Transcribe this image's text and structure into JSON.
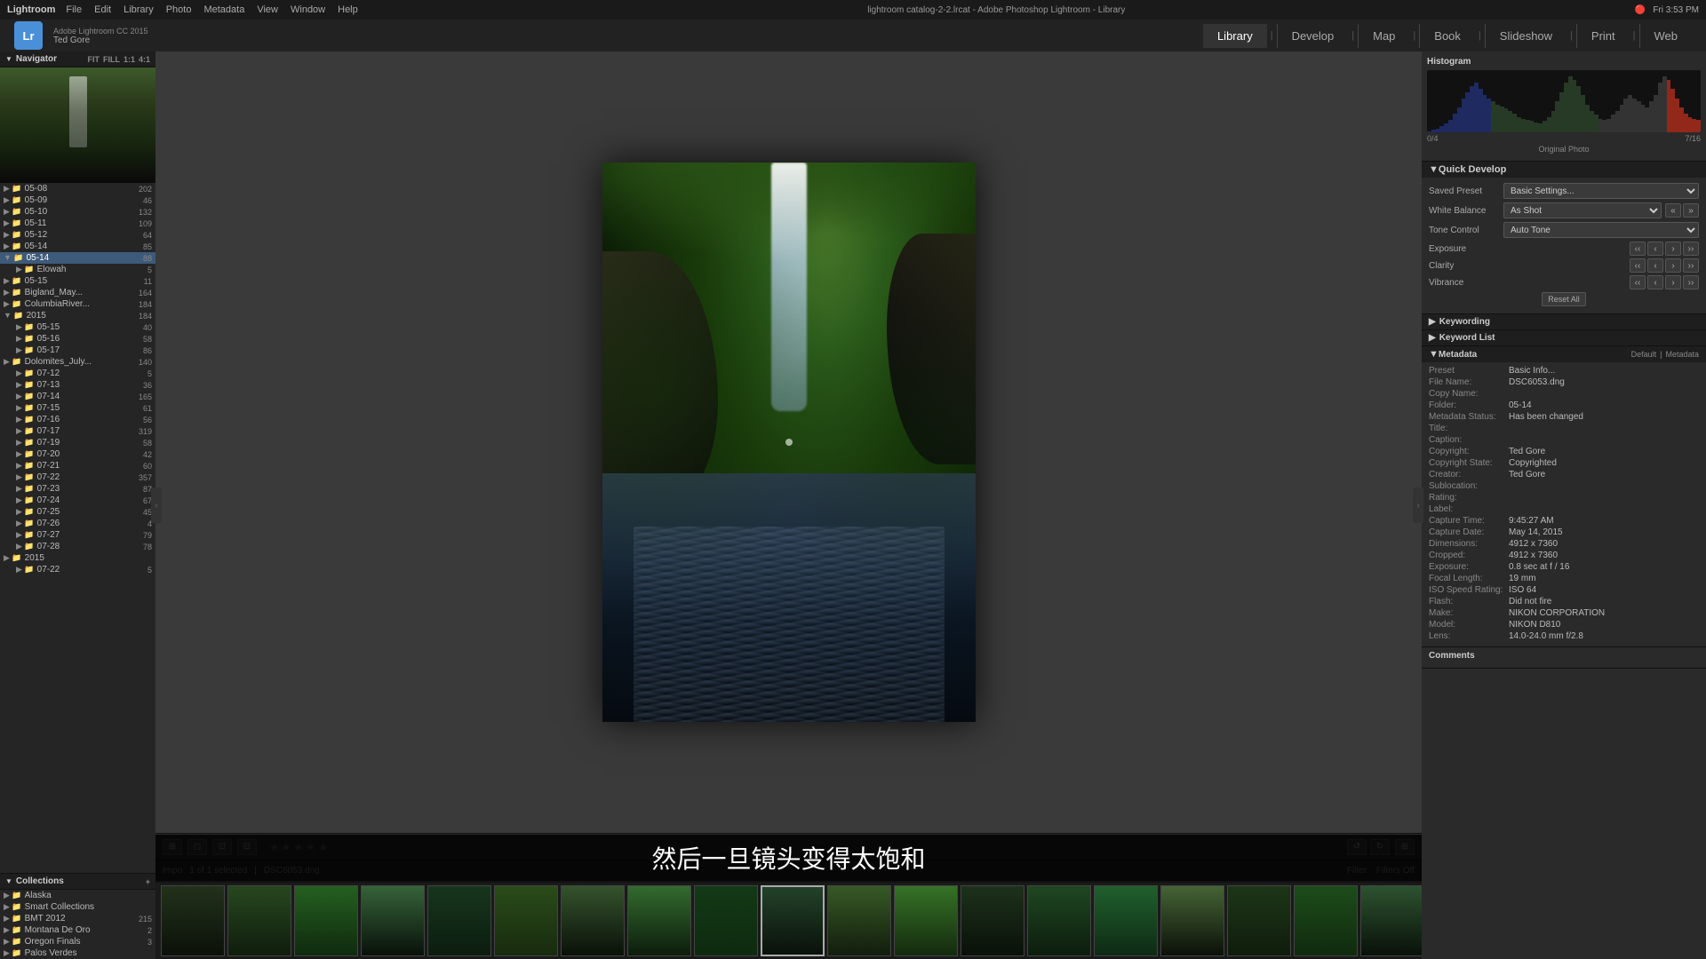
{
  "app": {
    "name": "Lightroom",
    "version": "Adobe Lightroom CC 2015",
    "user": "Ted Gore",
    "window_title": "lightroom catalog-2-2.lrcat - Adobe Photoshop Lightroom - Library"
  },
  "menu": {
    "items": [
      "File",
      "Edit",
      "Library",
      "Photo",
      "Metadata",
      "View",
      "Window",
      "Help"
    ]
  },
  "nav_tabs": [
    {
      "label": "Library",
      "active": true
    },
    {
      "label": "Develop"
    },
    {
      "label": "Map"
    },
    {
      "label": "Book"
    },
    {
      "label": "Slideshow"
    },
    {
      "label": "Print"
    },
    {
      "label": "Web"
    }
  ],
  "left_panel": {
    "navigator_label": "Navigator",
    "nav_controls": [
      "FIT",
      "FILL",
      "1:1",
      "4:1"
    ],
    "folders": [
      {
        "name": "05-08",
        "count": "202",
        "indent": 1
      },
      {
        "name": "05-09",
        "count": "46",
        "indent": 1
      },
      {
        "name": "05-10",
        "count": "132",
        "indent": 1
      },
      {
        "name": "05-11",
        "count": "109",
        "indent": 1
      },
      {
        "name": "05-12",
        "count": "64",
        "indent": 1
      },
      {
        "name": "05-14",
        "count": "85",
        "indent": 1
      },
      {
        "name": "05-14",
        "count": "88",
        "indent": 1,
        "selected": true,
        "expanded": true
      },
      {
        "name": "Elowah",
        "count": "5",
        "indent": 2
      },
      {
        "name": "05-15",
        "count": "11",
        "indent": 1
      },
      {
        "name": "Bigland_May...",
        "count": "164",
        "indent": 1
      },
      {
        "name": "ColumbiaRiver...",
        "count": "184",
        "indent": 1
      },
      {
        "name": "2015",
        "count": "184",
        "indent": 1,
        "expanded": true
      },
      {
        "name": "05-15",
        "count": "40",
        "indent": 2
      },
      {
        "name": "05-16",
        "count": "58",
        "indent": 2
      },
      {
        "name": "05-17",
        "count": "86",
        "indent": 2
      },
      {
        "name": "Dolomites_July...",
        "count": "140",
        "indent": 1
      },
      {
        "name": "07-12",
        "count": "5",
        "indent": 2
      },
      {
        "name": "07-13",
        "count": "36",
        "indent": 2
      },
      {
        "name": "07-14",
        "count": "165",
        "indent": 2
      },
      {
        "name": "07-15",
        "count": "61",
        "indent": 2
      },
      {
        "name": "07-16",
        "count": "56",
        "indent": 2
      },
      {
        "name": "07-17",
        "count": "319",
        "indent": 2
      },
      {
        "name": "07-19",
        "count": "58",
        "indent": 2
      },
      {
        "name": "07-20",
        "count": "42",
        "indent": 2
      },
      {
        "name": "07-21",
        "count": "60",
        "indent": 2
      },
      {
        "name": "07-22",
        "count": "357",
        "indent": 2
      },
      {
        "name": "07-23",
        "count": "87",
        "indent": 2
      },
      {
        "name": "07-24",
        "count": "67",
        "indent": 2
      },
      {
        "name": "07-25",
        "count": "45",
        "indent": 2
      },
      {
        "name": "07-26",
        "count": "4",
        "indent": 2
      },
      {
        "name": "07-27",
        "count": "79",
        "indent": 2
      },
      {
        "name": "07-28",
        "count": "78",
        "indent": 2
      },
      {
        "name": "2015",
        "count": "",
        "indent": 1
      },
      {
        "name": "07-22",
        "count": "5",
        "indent": 2
      }
    ],
    "collections_label": "Collections",
    "collections": [
      {
        "name": "Alaska",
        "indent": 1
      },
      {
        "name": "Smart Collections",
        "indent": 1
      },
      {
        "name": "BMT 2012",
        "count": "215",
        "indent": 1
      },
      {
        "name": "Montana De Oro",
        "count": "2",
        "indent": 1
      },
      {
        "name": "Oregon Finals",
        "count": "3",
        "indent": 1
      },
      {
        "name": "Palos Verdes",
        "count": "",
        "indent": 1
      }
    ]
  },
  "toolbar": {
    "view_btns": [
      "grid",
      "loupe",
      "compare",
      "survey"
    ],
    "stars": [
      "☆",
      "☆",
      "☆",
      "☆",
      "☆"
    ],
    "rotate_left": "↺",
    "rotate_right": "↻"
  },
  "info_bar": {
    "selection_info": "1 of 1 selected",
    "filename": "DSC6053.dng",
    "filter_label": "Filters Off"
  },
  "right_panel": {
    "histogram_title": "Histogram",
    "hist_info_left": "0/4",
    "hist_info_right": "7/16",
    "original_photo": "Original Photo",
    "quick_develop": {
      "title": "Quick Develop",
      "saved_preset_label": "Saved Preset",
      "saved_preset_value": "Basic Settings...",
      "white_balance_label": "White Balance",
      "white_balance_value": "As Shot",
      "tone_control_label": "Tone Control",
      "tone_control_value": "Auto Tone",
      "exposure_label": "Exposure",
      "clarity_label": "Clarity",
      "vibrance_label": "Vibrance",
      "reset_all": "Reset All"
    },
    "keywording": {
      "label": "Keywording"
    },
    "keyword_list": {
      "label": "Keyword List"
    },
    "metadata": {
      "title": "Metadata",
      "preset_label": "Preset",
      "preset_value": "Basic Info...",
      "tabs": [
        "Default",
        "Metadata"
      ],
      "fields": [
        {
          "key": "File Name:",
          "value": "DSC6053.dng"
        },
        {
          "key": "Copy Name:",
          "value": ""
        },
        {
          "key": "Folder:",
          "value": "05-14"
        },
        {
          "key": "Metadata Status:",
          "value": "Has been changed"
        },
        {
          "key": "Title:",
          "value": ""
        },
        {
          "key": "Caption:",
          "value": ""
        },
        {
          "key": "Copyright:",
          "value": "Ted Gore"
        },
        {
          "key": "Copyright State:",
          "value": "Copyrighted"
        },
        {
          "key": "Creator:",
          "value": "Ted Gore"
        },
        {
          "key": "Sublocation:",
          "value": ""
        },
        {
          "key": "Rating:",
          "value": ""
        },
        {
          "key": "Label:",
          "value": ""
        },
        {
          "key": "Capture Time:",
          "value": "9:45:27 AM"
        },
        {
          "key": "Capture Date:",
          "value": "May 14, 2015"
        },
        {
          "key": "Dimensions:",
          "value": "4912 x 7360"
        },
        {
          "key": "Cropped:",
          "value": "4912 x 7360"
        },
        {
          "key": "Exposure:",
          "value": "0.8 sec at f / 16"
        },
        {
          "key": "Focal Length:",
          "value": "19 mm"
        },
        {
          "key": "ISO Speed Rating:",
          "value": "ISO 64"
        },
        {
          "key": "Flash:",
          "value": "Did not fire"
        },
        {
          "key": "Make:",
          "value": "NIKON CORPORATION"
        },
        {
          "key": "Model:",
          "value": "NIKON D810"
        },
        {
          "key": "Lens:",
          "value": "14.0-24.0 mm f/2.8"
        }
      ]
    },
    "comments": {
      "title": "Comments"
    }
  },
  "subtitle": "然后一旦镜头变得太饱和",
  "filmstrip": {
    "thumb_count": 22,
    "active_index": 9
  }
}
